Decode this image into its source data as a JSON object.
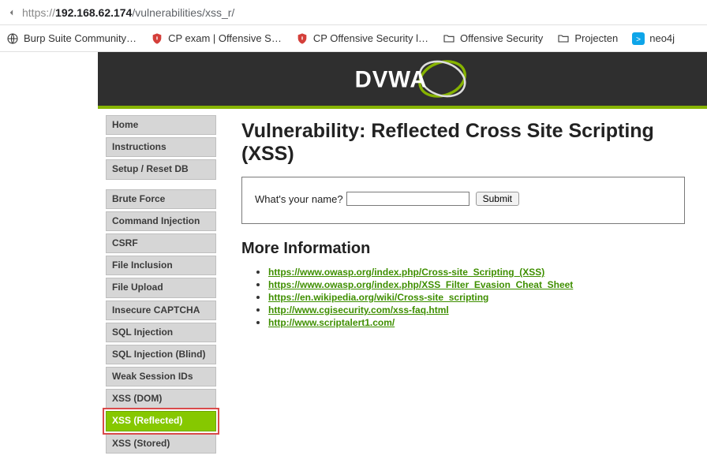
{
  "url": {
    "scheme": "https://",
    "host": "192.168.62.174",
    "path": "/vulnerabilities/xss_r/"
  },
  "bookmarks": [
    {
      "label": "Burp Suite Community…",
      "icon": "globe"
    },
    {
      "label": "CP exam | Offensive S…",
      "icon": "shield-red"
    },
    {
      "label": "CP Offensive Security l…",
      "icon": "shield-red"
    },
    {
      "label": "Offensive Security",
      "icon": "folder"
    },
    {
      "label": "Projecten",
      "icon": "folder"
    },
    {
      "label": "neo4j",
      "icon": "neo4j"
    }
  ],
  "logo_text": "DVWA",
  "sidebar": {
    "group1": [
      {
        "label": "Home"
      },
      {
        "label": "Instructions"
      },
      {
        "label": "Setup / Reset DB"
      }
    ],
    "group2": [
      {
        "label": "Brute Force"
      },
      {
        "label": "Command Injection"
      },
      {
        "label": "CSRF"
      },
      {
        "label": "File Inclusion"
      },
      {
        "label": "File Upload"
      },
      {
        "label": "Insecure CAPTCHA"
      },
      {
        "label": "SQL Injection"
      },
      {
        "label": "SQL Injection (Blind)"
      },
      {
        "label": "Weak Session IDs"
      },
      {
        "label": "XSS (DOM)"
      },
      {
        "label": "XSS (Reflected)",
        "active": true
      },
      {
        "label": "XSS (Stored)"
      }
    ]
  },
  "page": {
    "title": "Vulnerability: Reflected Cross Site Scripting (XSS)",
    "form_label": "What's your name?",
    "input_value": "",
    "submit_label": "Submit",
    "more_info_heading": "More Information",
    "links": [
      "https://www.owasp.org/index.php/Cross-site_Scripting_(XSS)",
      "https://www.owasp.org/index.php/XSS_Filter_Evasion_Cheat_Sheet",
      "https://en.wikipedia.org/wiki/Cross-site_scripting",
      "http://www.cgisecurity.com/xss-faq.html",
      "http://www.scriptalert1.com/"
    ]
  }
}
